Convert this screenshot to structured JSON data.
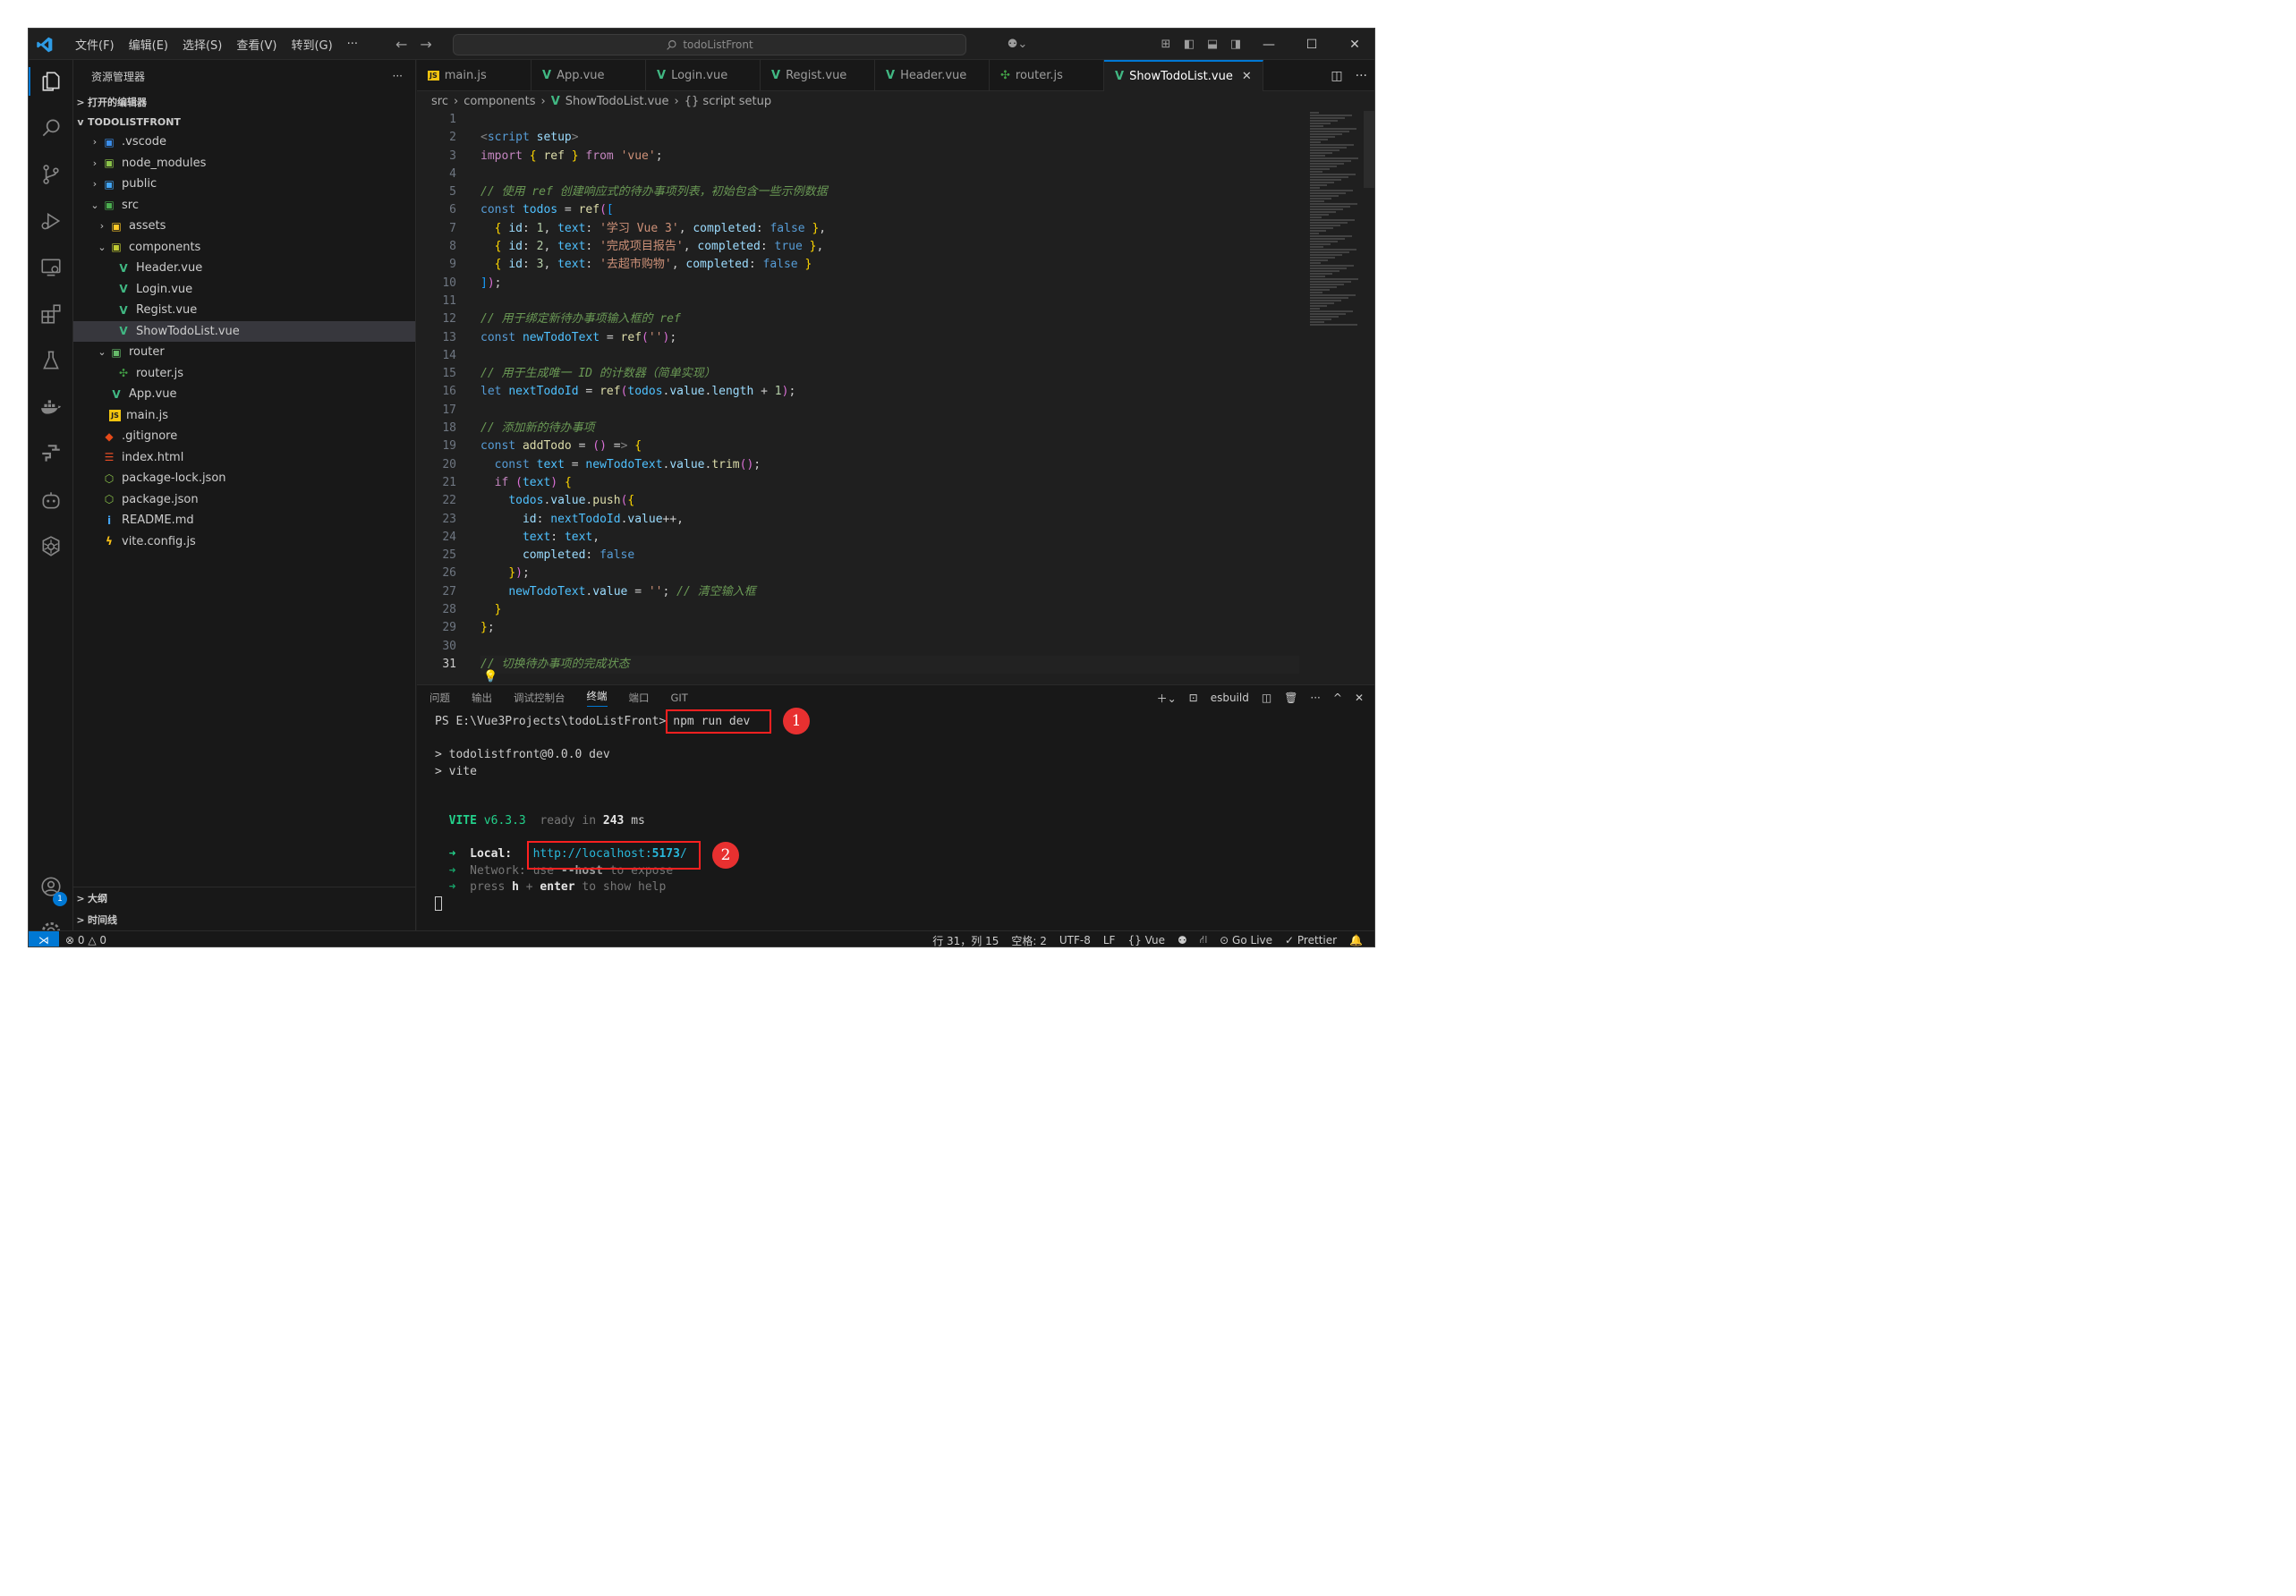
{
  "titlebar": {
    "menu": [
      "文件(F)",
      "编辑(E)",
      "选择(S)",
      "查看(V)",
      "转到(G)",
      "···"
    ],
    "search_text": "todoListFront"
  },
  "explorer": {
    "header": "资源管理器",
    "more": "···",
    "open_editors": "打开的编辑器",
    "project": "TODOLISTFRONT",
    "tree": [
      {
        "label": ".vscode",
        "depth": 1,
        "chev": ">",
        "icon": "folder-vscode-icon",
        "glyph": "▣",
        "color": "#3b8eea"
      },
      {
        "label": "node_modules",
        "depth": 1,
        "chev": ">",
        "icon": "folder-node-icon",
        "glyph": "▣",
        "color": "#8bc34a"
      },
      {
        "label": "public",
        "depth": 1,
        "chev": ">",
        "icon": "folder-public-icon",
        "glyph": "▣",
        "color": "#42a5f5"
      },
      {
        "label": "src",
        "depth": 1,
        "chev": "v",
        "icon": "folder-src-icon",
        "glyph": "▣",
        "color": "#4caf50"
      },
      {
        "label": "assets",
        "depth": 2,
        "chev": ">",
        "icon": "folder-assets-icon",
        "glyph": "▣",
        "color": "#ffca28"
      },
      {
        "label": "components",
        "depth": 2,
        "chev": "v",
        "icon": "folder-components-icon",
        "glyph": "▣",
        "color": "#c0ca33"
      },
      {
        "label": "Header.vue",
        "depth": 3,
        "chev": "",
        "icon": "vue-file-icon",
        "glyph": "V",
        "color": "#41b883"
      },
      {
        "label": "Login.vue",
        "depth": 3,
        "chev": "",
        "icon": "vue-file-icon",
        "glyph": "V",
        "color": "#41b883"
      },
      {
        "label": "Regist.vue",
        "depth": 3,
        "chev": "",
        "icon": "vue-file-icon",
        "glyph": "V",
        "color": "#41b883"
      },
      {
        "label": "ShowTodoList.vue",
        "depth": 3,
        "chev": "",
        "icon": "vue-file-icon",
        "glyph": "V",
        "color": "#41b883",
        "selected": true
      },
      {
        "label": "router",
        "depth": 2,
        "chev": "v",
        "icon": "folder-router-icon",
        "glyph": "▣",
        "color": "#66bb6a"
      },
      {
        "label": "router.js",
        "depth": 3,
        "chev": "",
        "icon": "router-file-icon",
        "glyph": "✣",
        "color": "#43a047"
      },
      {
        "label": "App.vue",
        "depth": 2,
        "chev": "",
        "icon": "vue-file-icon",
        "glyph": "V",
        "color": "#41b883"
      },
      {
        "label": "main.js",
        "depth": 2,
        "chev": "",
        "icon": "js-file-icon",
        "glyph": "JS",
        "color": "#f1c40f"
      },
      {
        "label": ".gitignore",
        "depth": 1,
        "chev": "",
        "icon": "git-file-icon",
        "glyph": "◆",
        "color": "#e64a19"
      },
      {
        "label": "index.html",
        "depth": 1,
        "chev": "",
        "icon": "html-file-icon",
        "glyph": "☰",
        "color": "#e44d26"
      },
      {
        "label": "package-lock.json",
        "depth": 1,
        "chev": "",
        "icon": "nodejs-file-icon",
        "glyph": "⬡",
        "color": "#8bc34a"
      },
      {
        "label": "package.json",
        "depth": 1,
        "chev": "",
        "icon": "nodejs-file-icon",
        "glyph": "⬡",
        "color": "#8bc34a"
      },
      {
        "label": "README.md",
        "depth": 1,
        "chev": "",
        "icon": "info-file-icon",
        "glyph": "i",
        "color": "#42a5f5"
      },
      {
        "label": "vite.config.js",
        "depth": 1,
        "chev": "",
        "icon": "vite-file-icon",
        "glyph": "ϟ",
        "color": "#ffc517"
      }
    ],
    "outline": "大纲",
    "timeline": "时间线"
  },
  "tabs": [
    {
      "label": "main.js",
      "icon": "js-file-icon",
      "glyph": "JS",
      "color": "#f1c40f"
    },
    {
      "label": "App.vue",
      "icon": "vue-file-icon",
      "glyph": "V",
      "color": "#41b883"
    },
    {
      "label": "Login.vue",
      "icon": "vue-file-icon",
      "glyph": "V",
      "color": "#41b883"
    },
    {
      "label": "Regist.vue",
      "icon": "vue-file-icon",
      "glyph": "V",
      "color": "#41b883"
    },
    {
      "label": "Header.vue",
      "icon": "vue-file-icon",
      "glyph": "V",
      "color": "#41b883"
    },
    {
      "label": "router.js",
      "icon": "router-file-icon",
      "glyph": "✣",
      "color": "#43a047"
    },
    {
      "label": "ShowTodoList.vue",
      "icon": "vue-file-icon",
      "glyph": "V",
      "color": "#41b883",
      "active": true
    }
  ],
  "breadcrumb": [
    "src",
    "components",
    "ShowTodoList.vue",
    "{} script setup"
  ],
  "editor": {
    "current_line": 31,
    "lines": [
      "",
      "<script setup>",
      "import { ref } from 'vue';",
      "",
      "// 使用 ref 创建响应式的待办事项列表，初始包含一些示例数据",
      "const todos = ref([",
      "  { id: 1, text: '学习 Vue 3', completed: false },",
      "  { id: 2, text: '完成项目报告', completed: true },",
      "  { id: 3, text: '去超市购物', completed: false }",
      "]);",
      "",
      "// 用于绑定新待办事项输入框的 ref",
      "const newTodoText = ref('');",
      "",
      "// 用于生成唯一 ID 的计数器（简单实现）",
      "let nextTodoId = ref(todos.value.length + 1);",
      "",
      "// 添加新的待办事项",
      "const addTodo = () => {",
      "  const text = newTodoText.value.trim();",
      "  if (text) {",
      "    todos.value.push({",
      "      id: nextTodoId.value++,",
      "      text: text,",
      "      completed: false",
      "    });",
      "    newTodoText.value = ''; // 清空输入框",
      "  }",
      "};",
      "",
      "// 切换待办事项的完成状态"
    ]
  },
  "panel": {
    "tabs": [
      "问题",
      "输出",
      "调试控制台",
      "终端",
      "端口",
      "GIT"
    ],
    "active_tab": "终端",
    "shell": "esbuild",
    "terminal": {
      "prompt": "PS E:\\Vue3Projects\\todoListFront>",
      "command": "npm run dev",
      "out1": "> todolistfront@0.0.0 dev",
      "out2": "> vite",
      "vite": "VITE",
      "version": "v6.3.3",
      "ready": "ready in",
      "ms_value": "243",
      "ms_unit": "ms",
      "arrow": "➜",
      "local_label": "Local:",
      "local_url_pre": "http://localhost:",
      "local_url_port": "5173",
      "local_url_post": "/",
      "network_label": "Network:",
      "network_use": "use",
      "network_host": "--host",
      "network_rest": "to expose",
      "help_press": "press",
      "help_h": "h",
      "help_plus": "+",
      "help_enter": "enter",
      "help_rest": "to show help"
    },
    "markers": [
      "1",
      "2"
    ]
  },
  "statusbar": {
    "errors": "0",
    "warnings": "0",
    "position": "行 31，列 15",
    "spaces": "空格: 2",
    "encoding": "UTF-8",
    "eol": "LF",
    "language": "Vue",
    "golive": "Go Live",
    "prettier": "Prettier"
  },
  "colors": {
    "accent": "#0078d4",
    "highlight_box": "#ff2020",
    "marker": "#e83030"
  }
}
